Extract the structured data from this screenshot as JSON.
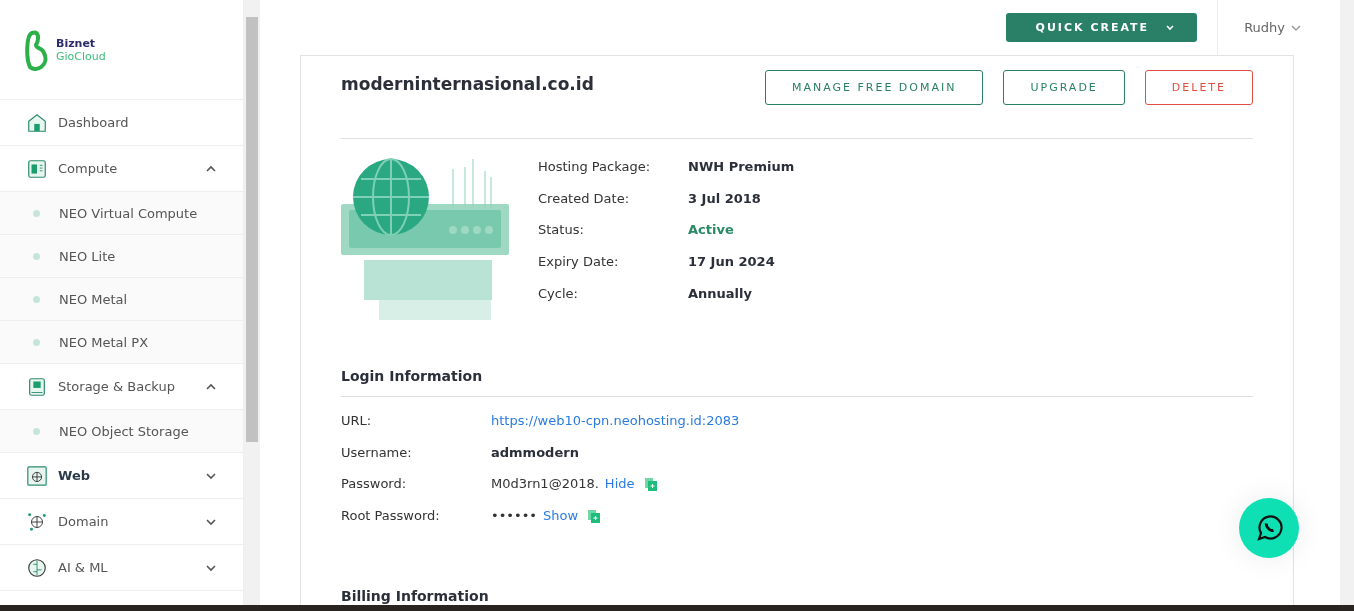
{
  "brand": {
    "line1": "Biznet",
    "line2": "GioCloud"
  },
  "sidebar": {
    "items": [
      {
        "kind": "section",
        "label": "Dashboard",
        "selected": false
      },
      {
        "kind": "section",
        "label": "Compute",
        "selected": false,
        "expanded": true
      },
      {
        "kind": "sub",
        "label": "NEO Virtual Compute",
        "selected": false
      },
      {
        "kind": "sub",
        "label": "NEO Lite",
        "selected": false
      },
      {
        "kind": "sub",
        "label": "NEO Metal",
        "selected": false
      },
      {
        "kind": "sub",
        "label": "NEO Metal PX",
        "selected": false
      },
      {
        "kind": "section",
        "label": "Storage & Backup",
        "selected": false,
        "expanded": true
      },
      {
        "kind": "sub",
        "label": "NEO Object Storage",
        "selected": false
      },
      {
        "kind": "section",
        "label": "Web",
        "selected": true,
        "expanded": false
      },
      {
        "kind": "section",
        "label": "Domain",
        "selected": false,
        "expanded": false
      },
      {
        "kind": "section",
        "label": "AI & ML",
        "selected": false,
        "expanded": false
      }
    ]
  },
  "topbar": {
    "quick_create": "QUICK CREATE",
    "user": "Rudhy"
  },
  "domain": {
    "title": "moderninternasional.co.id",
    "actions": [
      {
        "label": "MANAGE FREE DOMAIN",
        "kind": "primary"
      },
      {
        "label": "UPGRADE",
        "kind": "primary"
      },
      {
        "label": "DELETE",
        "kind": "danger"
      }
    ]
  },
  "details": [
    {
      "label": "Hosting Package:",
      "value": "NWH Premium",
      "kind": "plain"
    },
    {
      "label": "Created Date:",
      "value": "3 Jul 2018",
      "kind": "plain"
    },
    {
      "label": "Status:",
      "value": "Active",
      "kind": "status"
    },
    {
      "label": "Expiry Date:",
      "value": "17 Jun 2024",
      "kind": "plain"
    },
    {
      "label": "Cycle:",
      "value": "Annually",
      "kind": "plain"
    }
  ],
  "login": {
    "title": "Login Information",
    "rows": [
      {
        "label": "URL:",
        "value": "https://web10-cpn.neohosting.id:2083",
        "kind": "link"
      },
      {
        "label": "Username:",
        "value": "admmodern",
        "kind": "bold"
      },
      {
        "label": "Password:",
        "value": "M0d3rn1@2018.",
        "toggle": "Hide",
        "kind": "secret"
      },
      {
        "label": "Root Password:",
        "value": "••••••",
        "toggle": "Show",
        "kind": "secret"
      }
    ]
  },
  "billing": {
    "title": "Billing Information"
  }
}
